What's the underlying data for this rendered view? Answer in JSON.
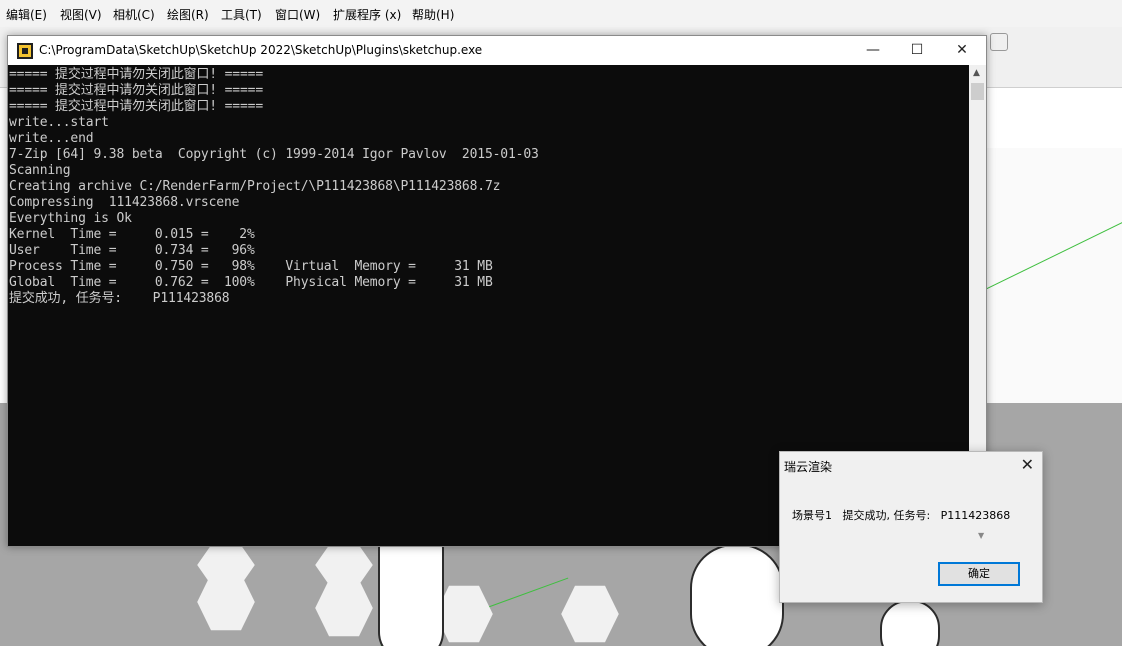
{
  "menubar": {
    "items": [
      "编辑(E)",
      "视图(V)",
      "相机(C)",
      "绘图(R)",
      "工具(T)",
      "窗口(W)",
      "扩展程序 (x)",
      "帮助(H)"
    ]
  },
  "console": {
    "title": "C:\\ProgramData\\SketchUp\\SketchUp 2022\\SketchUp\\Plugins\\sketchup.exe",
    "minimize": "—",
    "maximize": "☐",
    "close": "✕",
    "lines": [
      "===== 提交过程中请勿关闭此窗口! =====",
      "===== 提交过程中请勿关闭此窗口! =====",
      "===== 提交过程中请勿关闭此窗口! =====",
      "write...start",
      "write...end",
      "7-Zip [64] 9.38 beta  Copyright (c) 1999-2014 Igor Pavlov  2015-01-03",
      "Scanning",
      "Creating archive C:/RenderFarm/Project/\\P111423868\\P111423868.7z",
      "Compressing  111423868.vrscene",
      "Everything is Ok",
      "Kernel  Time =     0.015 =    2%",
      "User    Time =     0.734 =   96%",
      "Process Time =     0.750 =   98%    Virtual  Memory =     31 MB",
      "Global  Time =     0.762 =  100%    Physical Memory =     31 MB",
      "提交成功, 任务号:    P111423868"
    ]
  },
  "dialog": {
    "title": "瑞云渲染",
    "close": "✕",
    "message": "场景号1   提交成功, 任务号:   P111423868",
    "ok_label": "确定"
  },
  "colors": {
    "console_bg": "#0c0c0c",
    "console_text": "#cccccc",
    "accent": "#0078d7",
    "axis_green": "#3fbf3f"
  }
}
